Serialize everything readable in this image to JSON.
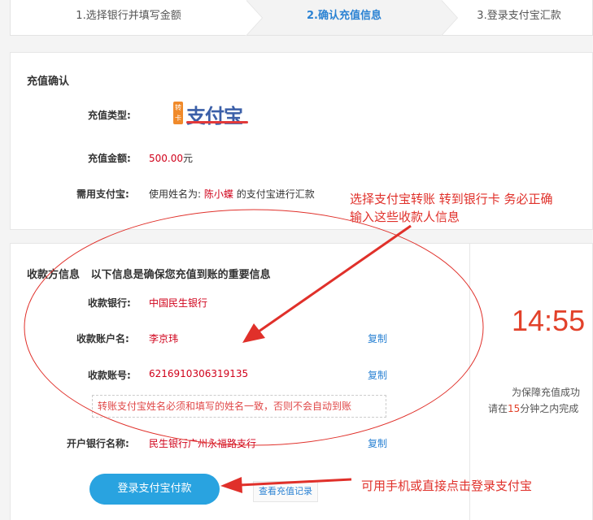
{
  "steps": {
    "step1": "1.选择银行并填写金额",
    "step2": "2.确认充值信息",
    "step3": "3.登录支付宝汇款"
  },
  "confirm": {
    "title": "充值确认",
    "type_label": "充值类型:",
    "type_tag": "转卡",
    "type_brand": "支付宝",
    "amount_label": "充值金额:",
    "amount_value": "500.00",
    "amount_unit": "元",
    "alipay_label": "需用支付宝:",
    "alipay_text_pre": "使用姓名为:",
    "alipay_name": "陈小蝶",
    "alipay_text_post": "的支付宝进行汇款"
  },
  "payee": {
    "title": "收款方信息",
    "subtitle": "以下信息是确保您充值到账的重要信息",
    "bank_label": "收款银行:",
    "bank_value": "中国民生银行",
    "name_label": "收款账户名:",
    "name_value": "李京玮",
    "account_label": "收款账号:",
    "account_value": "6216910306319135",
    "copy_label": "复制",
    "notice": "转账支付宝姓名必须和填写的姓名一致，否则不会自动到账",
    "branch_label": "开户银行名称:",
    "branch_value": "民生银行广州永福路支行"
  },
  "actions": {
    "pay_button": "登录支付宝付款",
    "records_button": "查看充值记录"
  },
  "timer": {
    "value": "14:55",
    "note1": "为保障充值成功",
    "note2_pre": "请在",
    "note2_num": "15",
    "note2_post": "分钟之内完成"
  },
  "annotations": {
    "top_line1": "选择支付宝转账 转到银行卡 务必正确",
    "top_line2": "输入这些收款人信息",
    "bottom": "可用手机或直接点击登录支付宝"
  },
  "colors": {
    "accent_blue": "#29a3e0",
    "link_blue": "#2a82d3",
    "emphasis_red": "#d0021b",
    "annotation_red": "#e0302a"
  }
}
